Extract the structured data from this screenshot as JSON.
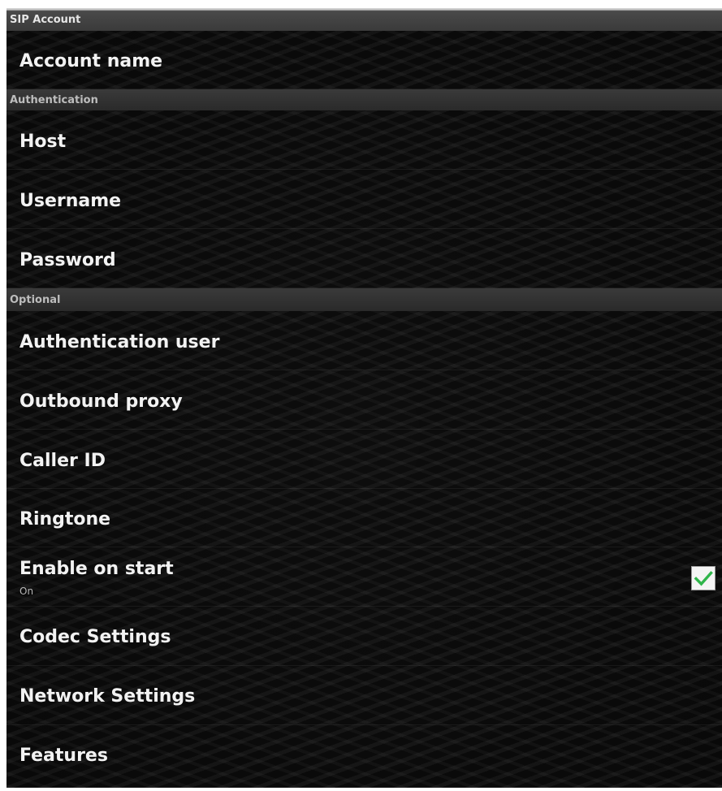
{
  "header": {
    "title": "SIP Account"
  },
  "account": {
    "name_label": "Account name"
  },
  "authentication": {
    "header": "Authentication",
    "items": [
      "Host",
      "Username",
      "Password"
    ]
  },
  "optional": {
    "header": "Optional",
    "items": [
      "Authentication user",
      "Outbound proxy",
      "Caller ID",
      "Ringtone"
    ],
    "enable_on_start": {
      "label": "Enable on start",
      "summary": "On",
      "checked": true
    },
    "more_items": [
      "Codec Settings",
      "Network Settings",
      "Features"
    ]
  },
  "colors": {
    "accent": "#2fb54a",
    "checkbox_bg": "#f4f4f4"
  },
  "icons": {
    "checkbox": "checkmark-icon"
  }
}
